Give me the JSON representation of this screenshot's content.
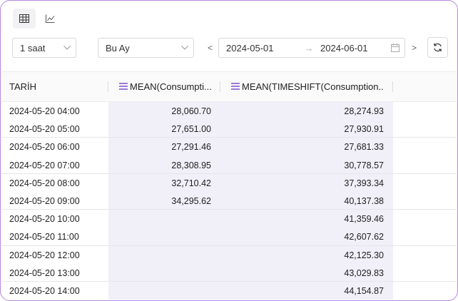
{
  "toolbar": {
    "view_icons": [
      "table-icon",
      "line-chart-icon"
    ],
    "interval": {
      "value": "1 saat"
    },
    "period": {
      "value": "Bu Ay"
    },
    "date_range": {
      "from": "2024-05-01",
      "to": "2024-06-01",
      "prev": "<",
      "next": ">",
      "separator": "→"
    }
  },
  "table": {
    "columns": [
      {
        "label": "TARİH"
      },
      {
        "label": "MEAN(Consumpti..."
      },
      {
        "label": "MEAN(TIMESHIFT(Consumption..."
      }
    ],
    "rows": [
      {
        "date": "2024-05-20 04:00",
        "v1": "28,060.70",
        "v2": "28,274.93"
      },
      {
        "date": "2024-05-20 05:00",
        "v1": "27,651.00",
        "v2": "27,930.91"
      },
      {
        "date": "2024-05-20 06:00",
        "v1": "27,291.46",
        "v2": "27,681.33"
      },
      {
        "date": "2024-05-20 07:00",
        "v1": "28,308.95",
        "v2": "30,778.57"
      },
      {
        "date": "2024-05-20 08:00",
        "v1": "32,710.42",
        "v2": "37,393.34"
      },
      {
        "date": "2024-05-20 09:00",
        "v1": "34,295.62",
        "v2": "40,137.38"
      },
      {
        "date": "2024-05-20 10:00",
        "v1": "",
        "v2": "41,359.46"
      },
      {
        "date": "2024-05-20 11:00",
        "v1": "",
        "v2": "42,607.62"
      },
      {
        "date": "2024-05-20 12:00",
        "v1": "",
        "v2": "42,125.30"
      },
      {
        "date": "2024-05-20 13:00",
        "v1": "",
        "v2": "43,029.83"
      },
      {
        "date": "2024-05-20 14:00",
        "v1": "",
        "v2": "44,154.87"
      }
    ]
  },
  "colors": {
    "accent": "#7b4fc9",
    "frame_border": "#b48ad8",
    "column_shade": "#f1eff8"
  }
}
